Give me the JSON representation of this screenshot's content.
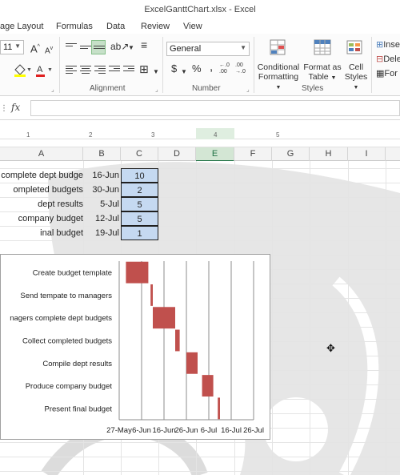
{
  "window": {
    "title": "ExcelGanttChart.xlsx - Excel"
  },
  "tabs": [
    "age Layout",
    "Formulas",
    "Data",
    "Review",
    "View"
  ],
  "ribbon": {
    "font_size": "11",
    "grow_font": "A",
    "shrink_font": "A",
    "number_format": "General",
    "currency": "$",
    "percent": "%",
    "comma": ",",
    "inc_decimal": "←.0 .00",
    "dec_decimal": ".00 →.0",
    "groups": {
      "alignment": "Alignment",
      "number": "Number",
      "styles": "Styles"
    },
    "styles_buttons": {
      "conditional": [
        "Conditional",
        "Formatting"
      ],
      "format_table": [
        "Format as",
        "Table"
      ],
      "cell_styles": [
        "Cell",
        "Styles"
      ]
    },
    "cells_buttons": [
      "Inse",
      "Dele",
      "For"
    ]
  },
  "formula_bar": {
    "fx": "fx",
    "name_box": ""
  },
  "ruler": {
    "ticks": [
      "1",
      "2",
      "3",
      "4",
      "5"
    ]
  },
  "columns": [
    "A",
    "B",
    "C",
    "D",
    "E",
    "F",
    "G",
    "H",
    "I"
  ],
  "selected_column": "E",
  "rows": [
    {
      "task": "rs complete dept budge",
      "date": "16-Jun",
      "days": "10"
    },
    {
      "task": "ompleted budgets",
      "date": "30-Jun",
      "days": "2"
    },
    {
      "task": "dept results",
      "date": "5-Jul",
      "days": "5"
    },
    {
      "task": "company budget",
      "date": "12-Jul",
      "days": "5"
    },
    {
      "task": "inal budget",
      "date": "19-Jul",
      "days": "1"
    }
  ],
  "colors": {
    "bar": "#c0504d",
    "selected_cells": "#c5d9f1",
    "accent": "#217346"
  },
  "chart_data": {
    "type": "bar",
    "orientation": "horizontal-gantt",
    "categories": [
      "Create budget template",
      "Send tempate to managers",
      "nagers complete dept budgets",
      "Collect completed budgets",
      "Compile dept results",
      "Produce company budget",
      "Present final budget"
    ],
    "x_ticks": [
      "27-May",
      "6-Jun",
      "16-Jun",
      "26-Jun",
      "6-Jul",
      "16-Jul",
      "26-Jul"
    ],
    "x_tick_values": [
      0,
      10,
      20,
      30,
      40,
      50,
      60
    ],
    "xlim": [
      0,
      60
    ],
    "series": [
      {
        "values": [
          [
            3,
            13
          ],
          [
            14,
            15
          ],
          [
            15,
            25
          ],
          [
            25,
            27
          ],
          [
            30,
            35
          ],
          [
            37,
            42
          ],
          [
            44,
            45
          ]
        ]
      }
    ],
    "grid": "vertical"
  }
}
